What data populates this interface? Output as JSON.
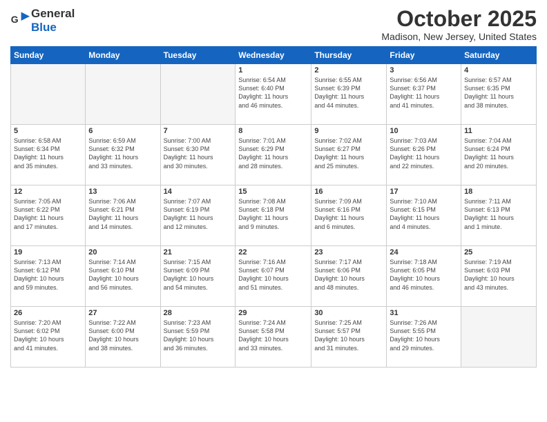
{
  "header": {
    "logo_general": "General",
    "logo_blue": "Blue",
    "month_year": "October 2025",
    "location": "Madison, New Jersey, United States"
  },
  "days_of_week": [
    "Sunday",
    "Monday",
    "Tuesday",
    "Wednesday",
    "Thursday",
    "Friday",
    "Saturday"
  ],
  "weeks": [
    [
      {
        "day": "",
        "info": ""
      },
      {
        "day": "",
        "info": ""
      },
      {
        "day": "",
        "info": ""
      },
      {
        "day": "1",
        "info": "Sunrise: 6:54 AM\nSunset: 6:40 PM\nDaylight: 11 hours\nand 46 minutes."
      },
      {
        "day": "2",
        "info": "Sunrise: 6:55 AM\nSunset: 6:39 PM\nDaylight: 11 hours\nand 44 minutes."
      },
      {
        "day": "3",
        "info": "Sunrise: 6:56 AM\nSunset: 6:37 PM\nDaylight: 11 hours\nand 41 minutes."
      },
      {
        "day": "4",
        "info": "Sunrise: 6:57 AM\nSunset: 6:35 PM\nDaylight: 11 hours\nand 38 minutes."
      }
    ],
    [
      {
        "day": "5",
        "info": "Sunrise: 6:58 AM\nSunset: 6:34 PM\nDaylight: 11 hours\nand 35 minutes."
      },
      {
        "day": "6",
        "info": "Sunrise: 6:59 AM\nSunset: 6:32 PM\nDaylight: 11 hours\nand 33 minutes."
      },
      {
        "day": "7",
        "info": "Sunrise: 7:00 AM\nSunset: 6:30 PM\nDaylight: 11 hours\nand 30 minutes."
      },
      {
        "day": "8",
        "info": "Sunrise: 7:01 AM\nSunset: 6:29 PM\nDaylight: 11 hours\nand 28 minutes."
      },
      {
        "day": "9",
        "info": "Sunrise: 7:02 AM\nSunset: 6:27 PM\nDaylight: 11 hours\nand 25 minutes."
      },
      {
        "day": "10",
        "info": "Sunrise: 7:03 AM\nSunset: 6:26 PM\nDaylight: 11 hours\nand 22 minutes."
      },
      {
        "day": "11",
        "info": "Sunrise: 7:04 AM\nSunset: 6:24 PM\nDaylight: 11 hours\nand 20 minutes."
      }
    ],
    [
      {
        "day": "12",
        "info": "Sunrise: 7:05 AM\nSunset: 6:22 PM\nDaylight: 11 hours\nand 17 minutes."
      },
      {
        "day": "13",
        "info": "Sunrise: 7:06 AM\nSunset: 6:21 PM\nDaylight: 11 hours\nand 14 minutes."
      },
      {
        "day": "14",
        "info": "Sunrise: 7:07 AM\nSunset: 6:19 PM\nDaylight: 11 hours\nand 12 minutes."
      },
      {
        "day": "15",
        "info": "Sunrise: 7:08 AM\nSunset: 6:18 PM\nDaylight: 11 hours\nand 9 minutes."
      },
      {
        "day": "16",
        "info": "Sunrise: 7:09 AM\nSunset: 6:16 PM\nDaylight: 11 hours\nand 6 minutes."
      },
      {
        "day": "17",
        "info": "Sunrise: 7:10 AM\nSunset: 6:15 PM\nDaylight: 11 hours\nand 4 minutes."
      },
      {
        "day": "18",
        "info": "Sunrise: 7:11 AM\nSunset: 6:13 PM\nDaylight: 11 hours\nand 1 minute."
      }
    ],
    [
      {
        "day": "19",
        "info": "Sunrise: 7:13 AM\nSunset: 6:12 PM\nDaylight: 10 hours\nand 59 minutes."
      },
      {
        "day": "20",
        "info": "Sunrise: 7:14 AM\nSunset: 6:10 PM\nDaylight: 10 hours\nand 56 minutes."
      },
      {
        "day": "21",
        "info": "Sunrise: 7:15 AM\nSunset: 6:09 PM\nDaylight: 10 hours\nand 54 minutes."
      },
      {
        "day": "22",
        "info": "Sunrise: 7:16 AM\nSunset: 6:07 PM\nDaylight: 10 hours\nand 51 minutes."
      },
      {
        "day": "23",
        "info": "Sunrise: 7:17 AM\nSunset: 6:06 PM\nDaylight: 10 hours\nand 48 minutes."
      },
      {
        "day": "24",
        "info": "Sunrise: 7:18 AM\nSunset: 6:05 PM\nDaylight: 10 hours\nand 46 minutes."
      },
      {
        "day": "25",
        "info": "Sunrise: 7:19 AM\nSunset: 6:03 PM\nDaylight: 10 hours\nand 43 minutes."
      }
    ],
    [
      {
        "day": "26",
        "info": "Sunrise: 7:20 AM\nSunset: 6:02 PM\nDaylight: 10 hours\nand 41 minutes."
      },
      {
        "day": "27",
        "info": "Sunrise: 7:22 AM\nSunset: 6:00 PM\nDaylight: 10 hours\nand 38 minutes."
      },
      {
        "day": "28",
        "info": "Sunrise: 7:23 AM\nSunset: 5:59 PM\nDaylight: 10 hours\nand 36 minutes."
      },
      {
        "day": "29",
        "info": "Sunrise: 7:24 AM\nSunset: 5:58 PM\nDaylight: 10 hours\nand 33 minutes."
      },
      {
        "day": "30",
        "info": "Sunrise: 7:25 AM\nSunset: 5:57 PM\nDaylight: 10 hours\nand 31 minutes."
      },
      {
        "day": "31",
        "info": "Sunrise: 7:26 AM\nSunset: 5:55 PM\nDaylight: 10 hours\nand 29 minutes."
      },
      {
        "day": "",
        "info": ""
      }
    ]
  ]
}
